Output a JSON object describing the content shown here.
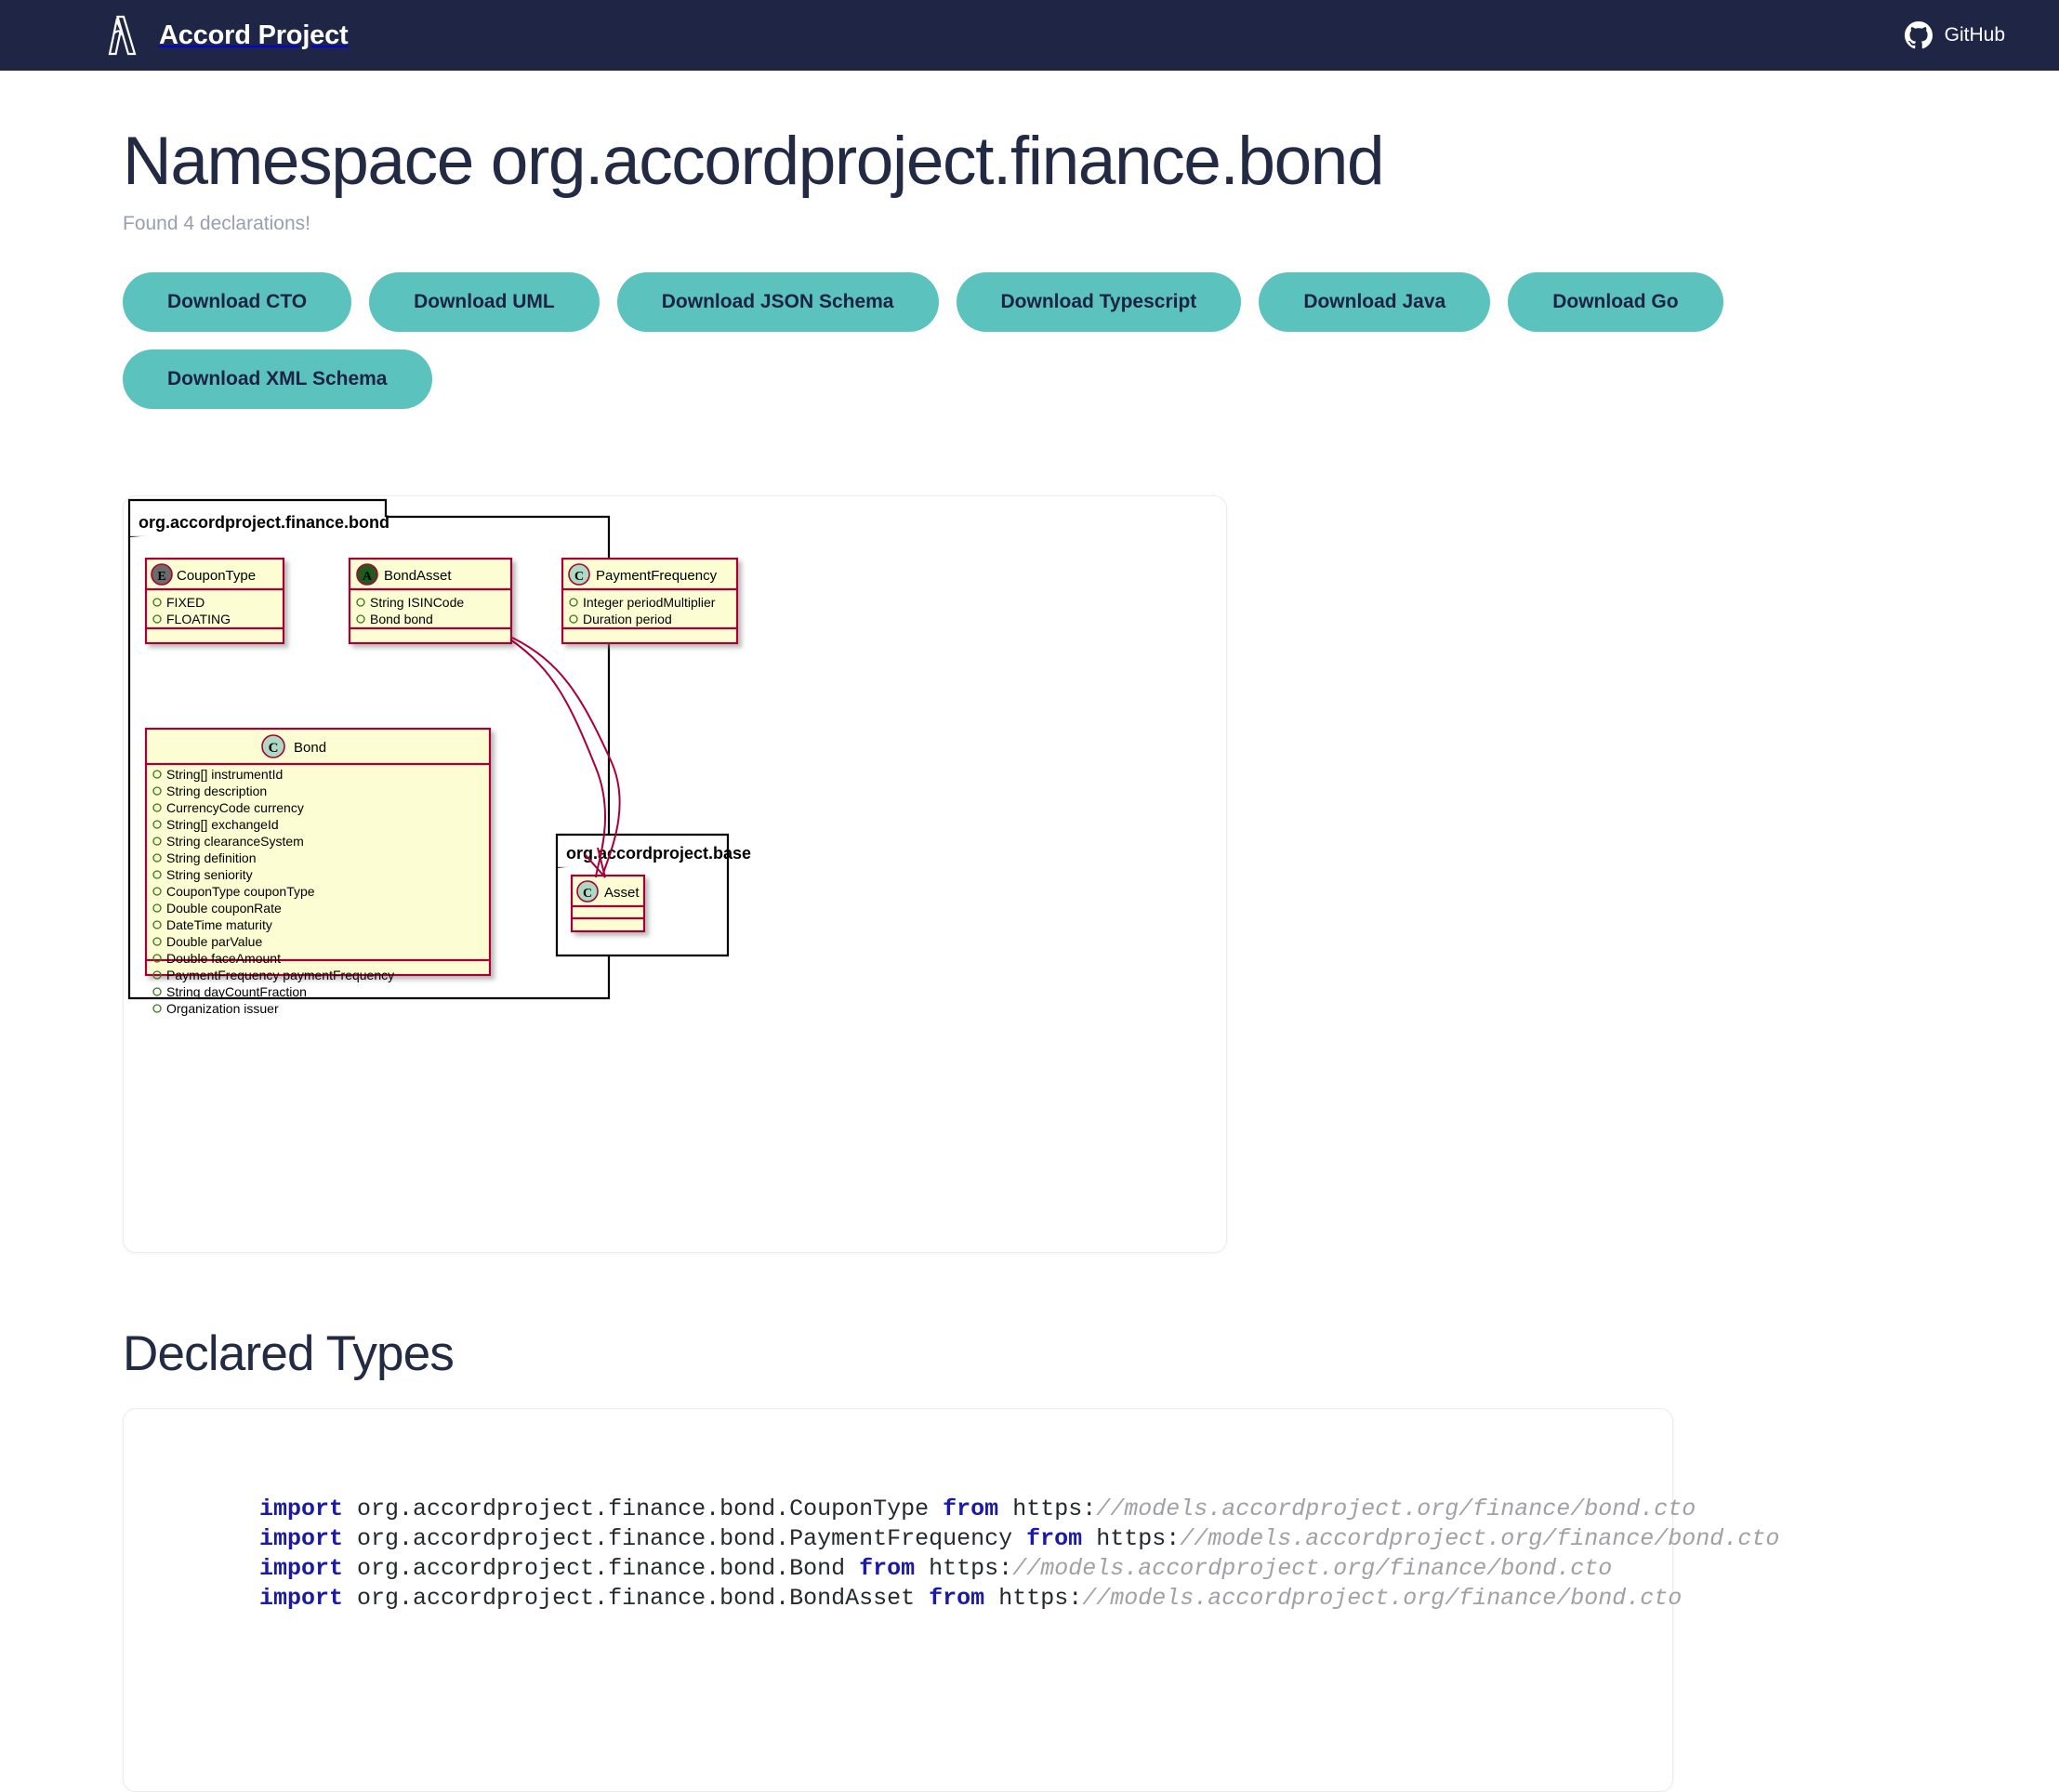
{
  "navbar": {
    "brand": "Accord Project",
    "brand_logo_icon": "accord-project-logo-icon",
    "github_label": "GitHub",
    "github_icon": "github-icon",
    "background_color": "#1f2545"
  },
  "header": {
    "title": "Namespace org.accordproject.finance.bond",
    "subtitle": "Found 4 declarations!"
  },
  "downloads": {
    "accent_color": "#5BC2BE",
    "text_color": "#1c2344",
    "buttons": [
      {
        "label": "Download CTO",
        "name": "download-cto-button"
      },
      {
        "label": "Download UML",
        "name": "download-uml-button"
      },
      {
        "label": "Download JSON Schema",
        "name": "download-json-schema-button"
      },
      {
        "label": "Download Typescript",
        "name": "download-typescript-button"
      },
      {
        "label": "Download Java",
        "name": "download-java-button"
      },
      {
        "label": "Download Go",
        "name": "download-go-button"
      },
      {
        "label": "Download XML Schema",
        "name": "download-xml-schema-button"
      }
    ]
  },
  "diagram": {
    "packages": [
      {
        "name": "org.accordproject.finance.bond",
        "classes": [
          {
            "name": "CouponType",
            "stereotype": "E",
            "stereotype_color": "#6b6b6b",
            "members": [
              "FIXED",
              "FLOATING"
            ]
          },
          {
            "name": "BondAsset",
            "stereotype": "A",
            "stereotype_color": "#1d5c1d",
            "members": [
              "String ISINCode",
              "Bond bond"
            ]
          },
          {
            "name": "PaymentFrequency",
            "stereotype": "C",
            "stereotype_color": "#add8c4",
            "members": [
              "Integer periodMultiplier",
              "Duration period"
            ]
          },
          {
            "name": "Bond",
            "stereotype": "C",
            "stereotype_color": "#add8c4",
            "members": [
              "String[] instrumentId",
              "String description",
              "CurrencyCode currency",
              "String[] exchangeId",
              "String clearanceSystem",
              "String definition",
              "String seniority",
              "CouponType couponType",
              "Double couponRate",
              "DateTime maturity",
              "Double parValue",
              "Double faceAmount",
              "PaymentFrequency paymentFrequency",
              "String dayCountFraction",
              "Organization issuer"
            ]
          }
        ]
      },
      {
        "name": "org.accordproject.base",
        "classes": [
          {
            "name": "Asset",
            "stereotype": "C",
            "stereotype_color": "#add8c4",
            "members": []
          }
        ]
      }
    ],
    "relations": [
      {
        "from": "BondAsset",
        "to": "Asset",
        "kind": "extends"
      }
    ],
    "colors": {
      "class_fill": "#fdfdd4",
      "class_border": "#a80036",
      "package_border": "#000000"
    }
  },
  "declared_types": {
    "heading": "Declared Types",
    "imports": [
      {
        "kw_import": "import",
        "fqn": "org.accordproject.finance.bond.CouponType",
        "kw_from": "from",
        "scheme": "https:",
        "url": "//models.accordproject.org/finance/bond.cto"
      },
      {
        "kw_import": "import",
        "fqn": "org.accordproject.finance.bond.PaymentFrequency",
        "kw_from": "from",
        "scheme": "https:",
        "url": "//models.accordproject.org/finance/bond.cto"
      },
      {
        "kw_import": "import",
        "fqn": "org.accordproject.finance.bond.Bond",
        "kw_from": "from",
        "scheme": "https:",
        "url": "//models.accordproject.org/finance/bond.cto"
      },
      {
        "kw_import": "import",
        "fqn": "org.accordproject.finance.bond.BondAsset",
        "kw_from": "from",
        "scheme": "https:",
        "url": "//models.accordproject.org/finance/bond.cto"
      }
    ]
  }
}
